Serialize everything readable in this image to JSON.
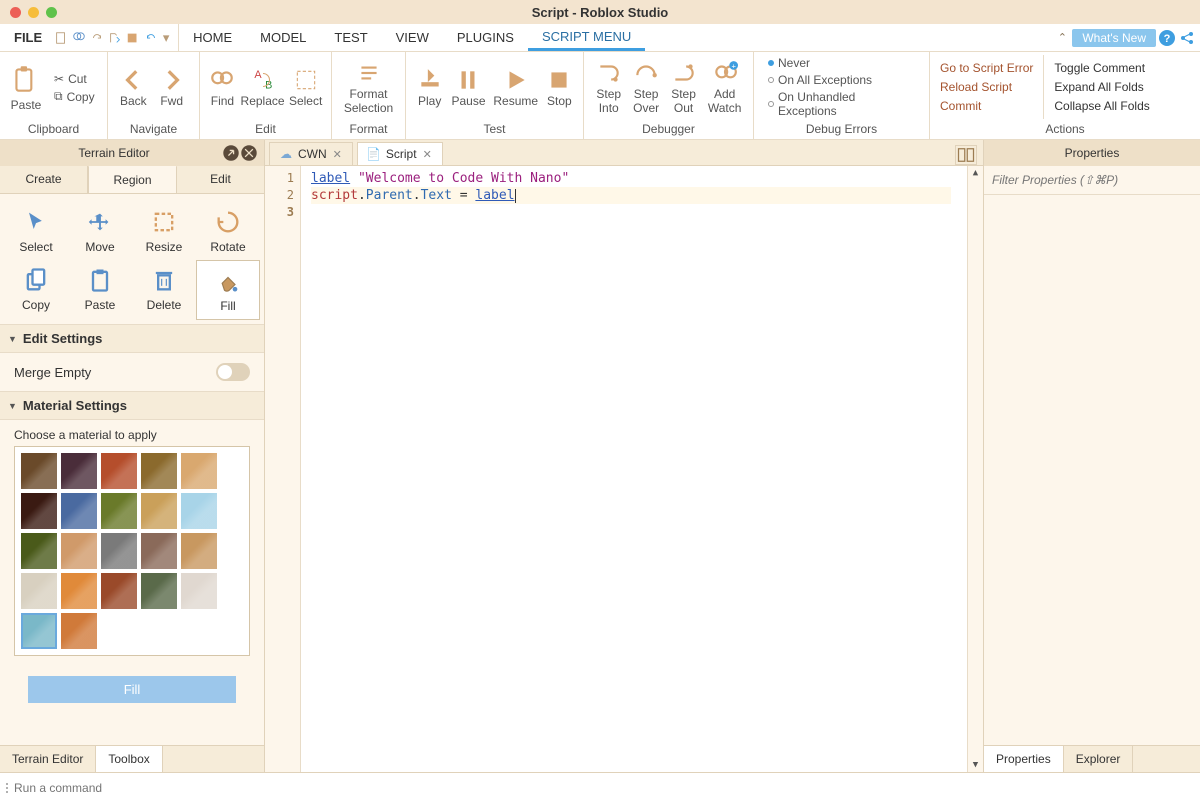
{
  "title": "Script - Roblox Studio",
  "menubar": {
    "file": "FILE",
    "tabs": [
      "HOME",
      "MODEL",
      "TEST",
      "VIEW",
      "PLUGINS",
      "SCRIPT MENU"
    ],
    "active_tab": "SCRIPT MENU",
    "whats_new": "What's New"
  },
  "ribbon": {
    "clipboard": {
      "label": "Clipboard",
      "paste": "Paste",
      "cut": "Cut",
      "copy": "Copy"
    },
    "navigate": {
      "label": "Navigate",
      "back": "Back",
      "fwd": "Fwd"
    },
    "edit": {
      "label": "Edit",
      "find": "Find",
      "replace": "Replace",
      "select": "Select"
    },
    "format": {
      "label": "Format",
      "format_selection": "Format\nSelection"
    },
    "test": {
      "label": "Test",
      "play": "Play",
      "pause": "Pause",
      "resume": "Resume",
      "stop": "Stop"
    },
    "debugger": {
      "label": "Debugger",
      "step_into": "Step\nInto",
      "step_over": "Step\nOver",
      "step_out": "Step\nOut",
      "add_watch": "Add\nWatch"
    },
    "debug_errors": {
      "label": "Debug Errors",
      "never": "Never",
      "on_all": "On All Exceptions",
      "on_unhandled": "On Unhandled Exceptions"
    },
    "actions": {
      "label": "Actions",
      "goto": "Go to Script Error",
      "reload": "Reload Script",
      "commit": "Commit",
      "toggle": "Toggle Comment",
      "expand": "Expand All Folds",
      "collapse": "Collapse All Folds"
    }
  },
  "terrain": {
    "title": "Terrain Editor",
    "subtabs": [
      "Create",
      "Region",
      "Edit"
    ],
    "active_subtab": "Region",
    "tools": [
      {
        "name": "Select"
      },
      {
        "name": "Move"
      },
      {
        "name": "Resize"
      },
      {
        "name": "Rotate"
      },
      {
        "name": "Copy"
      },
      {
        "name": "Paste"
      },
      {
        "name": "Delete"
      },
      {
        "name": "Fill"
      }
    ],
    "selected_tool": "Fill",
    "edit_settings_header": "Edit Settings",
    "merge_empty": "Merge Empty",
    "material_header": "Material Settings",
    "choose_material": "Choose a material to apply",
    "material_colors": [
      "#6a4a2a",
      "#4a2d3a",
      "#b54e2c",
      "#8b6a2d",
      "#d9a86f",
      "#3a1a12",
      "#4a6aa0",
      "#6a7a2a",
      "#caa05a",
      "#a8d4e8",
      "#4a5a1a",
      "#d09a6a",
      "#7a7a7a",
      "#8a6a5a",
      "#c89860",
      "#d8d0c0",
      "#e08a3a",
      "#9a4a2a",
      "#5a6a4a",
      "#e0d8d0",
      "#7ab8c8",
      "#d07a3a"
    ],
    "selected_material_index": 20,
    "fill_button": "Fill",
    "bottom_tabs": [
      "Terrain Editor",
      "Toolbox"
    ],
    "active_bottom": "Toolbox"
  },
  "docs": {
    "tabs": [
      {
        "label": "CWN",
        "icon": "cloud"
      },
      {
        "label": "Script",
        "icon": "script"
      }
    ],
    "active": "Script"
  },
  "code": {
    "lines": [
      {
        "n": 1,
        "tokens": [
          {
            "t": "label",
            "c": "id"
          },
          {
            "t": " ",
            "c": ""
          },
          {
            "t": "\"Welcome to Code With Nano\"",
            "c": "str"
          }
        ]
      },
      {
        "n": 2,
        "tokens": []
      },
      {
        "n": 3,
        "tokens": [
          {
            "t": "script",
            "c": "kw"
          },
          {
            "t": ".",
            "c": "dot"
          },
          {
            "t": "Parent",
            "c": "prop"
          },
          {
            "t": ".",
            "c": "dot"
          },
          {
            "t": "Text",
            "c": "prop"
          },
          {
            "t": " = ",
            "c": "dot"
          },
          {
            "t": "label",
            "c": "id"
          }
        ],
        "current": true
      }
    ]
  },
  "properties": {
    "title": "Properties",
    "filter_placeholder": "Filter Properties (⇧⌘P)",
    "bottom_tabs": [
      "Properties",
      "Explorer"
    ],
    "active": "Properties"
  },
  "command_bar": {
    "placeholder": "Run a command"
  }
}
